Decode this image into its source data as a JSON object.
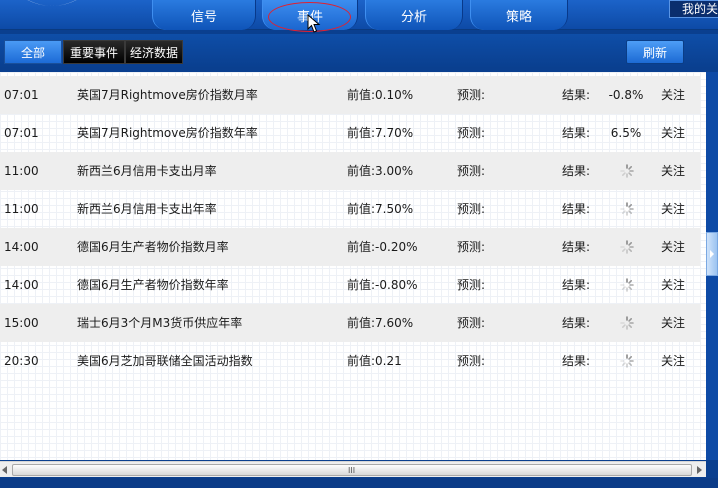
{
  "nav": {
    "tabs": [
      {
        "label": "信号"
      },
      {
        "label": "事件"
      },
      {
        "label": "分析"
      },
      {
        "label": "策略"
      }
    ],
    "active_tab": "事件",
    "my_button": "我的关"
  },
  "toolbar": {
    "filters": [
      "全部",
      "重要事件",
      "经济数据"
    ],
    "selected_filter": "全部",
    "refresh_label": "刷新"
  },
  "events": [
    {
      "time": "07:01",
      "title": "英国7月Rightmove房价指数月率",
      "previous": "前值:0.10%",
      "forecast": "预测:",
      "result_label": "结果:",
      "result": "-0.8%",
      "follow": "关注",
      "loading": false
    },
    {
      "time": "07:01",
      "title": "英国7月Rightmove房价指数年率",
      "previous": "前值:7.70%",
      "forecast": "预测:",
      "result_label": "结果:",
      "result": "6.5%",
      "follow": "关注",
      "loading": false
    },
    {
      "time": "11:00",
      "title": "新西兰6月信用卡支出月率",
      "previous": "前值:3.00%",
      "forecast": "预测:",
      "result_label": "结果:",
      "result": "",
      "follow": "关注",
      "loading": true
    },
    {
      "time": "11:00",
      "title": "新西兰6月信用卡支出年率",
      "previous": "前值:7.50%",
      "forecast": "预测:",
      "result_label": "结果:",
      "result": "",
      "follow": "关注",
      "loading": true
    },
    {
      "time": "14:00",
      "title": "德国6月生产者物价指数月率",
      "previous": "前值:-0.20%",
      "forecast": "预测:",
      "result_label": "结果:",
      "result": "",
      "follow": "关注",
      "loading": true
    },
    {
      "time": "14:00",
      "title": "德国6月生产者物价指数年率",
      "previous": "前值:-0.80%",
      "forecast": "预测:",
      "result_label": "结果:",
      "result": "",
      "follow": "关注",
      "loading": true
    },
    {
      "time": "15:00",
      "title": "瑞士6月3个月M3货币供应年率",
      "previous": "前值:7.60%",
      "forecast": "预测:",
      "result_label": "结果:",
      "result": "",
      "follow": "关注",
      "loading": true
    },
    {
      "time": "20:30",
      "title": "美国6月芝加哥联储全国活动指数",
      "previous": "前值:0.21",
      "forecast": "预测:",
      "result_label": "结果:",
      "result": "",
      "follow": "关注",
      "loading": true
    }
  ],
  "colors": {
    "nav_blue": "#0d4aa6",
    "accent_blue": "#1d6bd6",
    "highlight_red": "#d23"
  }
}
